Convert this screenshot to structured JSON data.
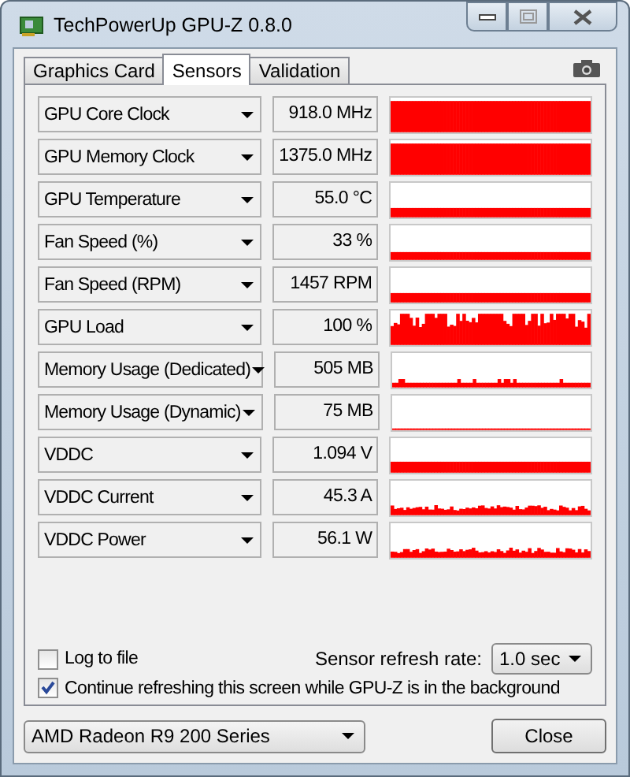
{
  "window": {
    "title": "TechPowerUp GPU-Z 0.8.0"
  },
  "tabs": [
    {
      "label": "Graphics Card",
      "selected": false
    },
    {
      "label": "Sensors",
      "selected": true
    },
    {
      "label": "Validation",
      "selected": false
    }
  ],
  "sensors": [
    {
      "name": "GPU Core Clock",
      "reading": "918.0 MHz"
    },
    {
      "name": "GPU Memory Clock",
      "reading": "1375.0 MHz"
    },
    {
      "name": "GPU Temperature",
      "reading": "55.0 °C"
    },
    {
      "name": "Fan Speed (%)",
      "reading": "33 %"
    },
    {
      "name": "Fan Speed (RPM)",
      "reading": "1457 RPM"
    },
    {
      "name": "GPU Load",
      "reading": "100 %"
    },
    {
      "name": "Memory Usage (Dedicated)",
      "reading": "505 MB"
    },
    {
      "name": "Memory Usage (Dynamic)",
      "reading": "75 MB"
    },
    {
      "name": "VDDC",
      "reading": "1.094 V"
    },
    {
      "name": "VDDC Current",
      "reading": "45.3 A"
    },
    {
      "name": "VDDC Power",
      "reading": "56.1 W"
    }
  ],
  "log_to_file": {
    "label": "Log to file",
    "checked": false
  },
  "refresh_rate": {
    "label": "Sensor refresh rate:",
    "value": "1.0 sec"
  },
  "continue_refreshing": {
    "label": "Continue refreshing this screen while GPU-Z is in the background",
    "checked": true
  },
  "device": {
    "value": "AMD Radeon R9 200 Series"
  },
  "close_button": "Close"
}
